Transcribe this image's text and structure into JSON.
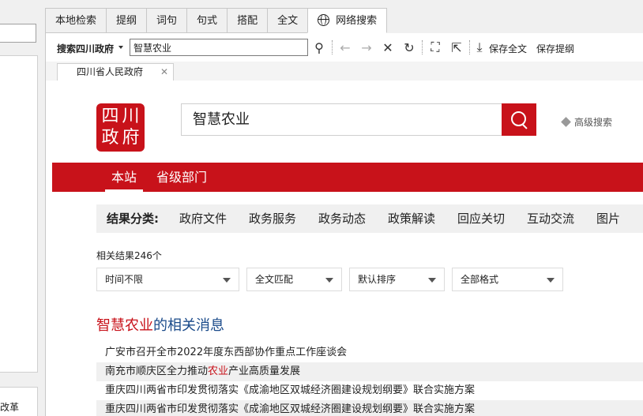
{
  "left_pane": {
    "bottom_text": "改革"
  },
  "tabs": [
    {
      "label": "本地检索",
      "active": false
    },
    {
      "label": "提纲",
      "active": false
    },
    {
      "label": "词句",
      "active": false
    },
    {
      "label": "句式",
      "active": false
    },
    {
      "label": "搭配",
      "active": false
    },
    {
      "label": "全文",
      "active": false
    },
    {
      "label": "网络搜索",
      "active": true,
      "icon": "globe-icon"
    }
  ],
  "toolbar": {
    "source_label": "搜索四川政府",
    "query": "智慧农业",
    "save_full_label": "保存全文",
    "save_outline_label": "保存提纲"
  },
  "page_tab": {
    "title": "四川省人民政府"
  },
  "site": {
    "logo_chars": [
      "四",
      "川",
      "政",
      "府"
    ],
    "search_value": "智慧农业",
    "advanced_label": "高级搜索",
    "nav": [
      {
        "label": "本站",
        "active": true
      },
      {
        "label": "省级部门",
        "active": false
      }
    ],
    "class_label": "结果分类:",
    "classes": [
      "政府文件",
      "政务服务",
      "政务动态",
      "政策解读",
      "回应关切",
      "互动交流",
      "图片"
    ],
    "count_text": "相关结果246个",
    "filters": [
      "时间不限",
      "全文匹配",
      "默认排序",
      "全部格式"
    ],
    "result_title_hl": "智慧农业",
    "result_title_rest": "的相关消息",
    "results": [
      {
        "pre": "广安市召开全市2022年度东西部协作重点工作座谈会",
        "hl": "",
        "post": ""
      },
      {
        "pre": "南充市顺庆区全力推动",
        "hl": "农业",
        "post": "产业高质量发展"
      },
      {
        "pre": "重庆四川两省市印发贯彻落实《成渝地区双城经济圈建设规划纲要》联合实施方案",
        "hl": "",
        "post": ""
      },
      {
        "pre": "重庆四川两省市印发贯彻落实《成渝地区双城经济圈建设规划纲要》联合实施方案",
        "hl": "",
        "post": ""
      }
    ]
  },
  "colors": {
    "brand_red": "#c8121a",
    "link_blue": "#1a4a8a"
  }
}
